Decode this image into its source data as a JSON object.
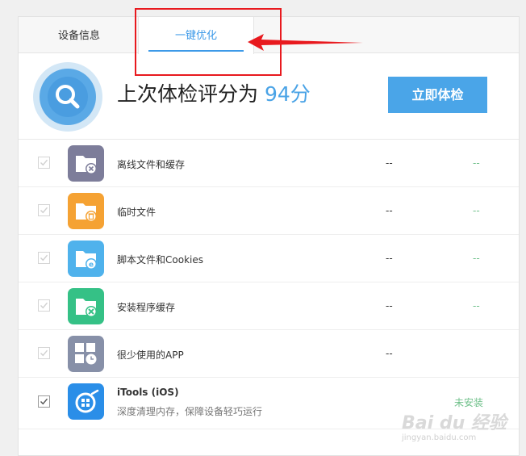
{
  "tabs": {
    "device_info": "设备信息",
    "one_click_optimize": "一键优化"
  },
  "summary": {
    "score_prefix": "上次体检评分为",
    "score_value": "94",
    "score_suffix": "分",
    "check_button": "立即体检"
  },
  "rows": [
    {
      "label": "离线文件和缓存",
      "size": "--",
      "status": "--",
      "icon": "folder-delete-icon",
      "color": "#7f7f9c",
      "checked": true
    },
    {
      "label": "临时文件",
      "size": "--",
      "status": "--",
      "icon": "folder-trash-icon",
      "color": "#f5a233",
      "checked": true
    },
    {
      "label": "脚本文件和Cookies",
      "size": "--",
      "status": "--",
      "icon": "folder-browser-icon",
      "color": "#4fb2ec",
      "checked": true
    },
    {
      "label": "安装程序缓存",
      "size": "--",
      "status": "--",
      "icon": "folder-tools-icon",
      "color": "#35c186",
      "checked": true
    },
    {
      "label": "很少使用的APP",
      "size": "--",
      "status": "",
      "icon": "apps-clock-icon",
      "color": "#8790a8",
      "checked": true
    }
  ],
  "itools": {
    "title": "iTools (iOS)",
    "subtitle": "深度清理内存，保障设备轻巧运行",
    "status": "未安装",
    "icon": "itools-icon",
    "color": "#2a8ee8",
    "checked": true
  },
  "watermark": {
    "main": "Bai du 经验",
    "sub": "jingyan.baidu.com"
  }
}
